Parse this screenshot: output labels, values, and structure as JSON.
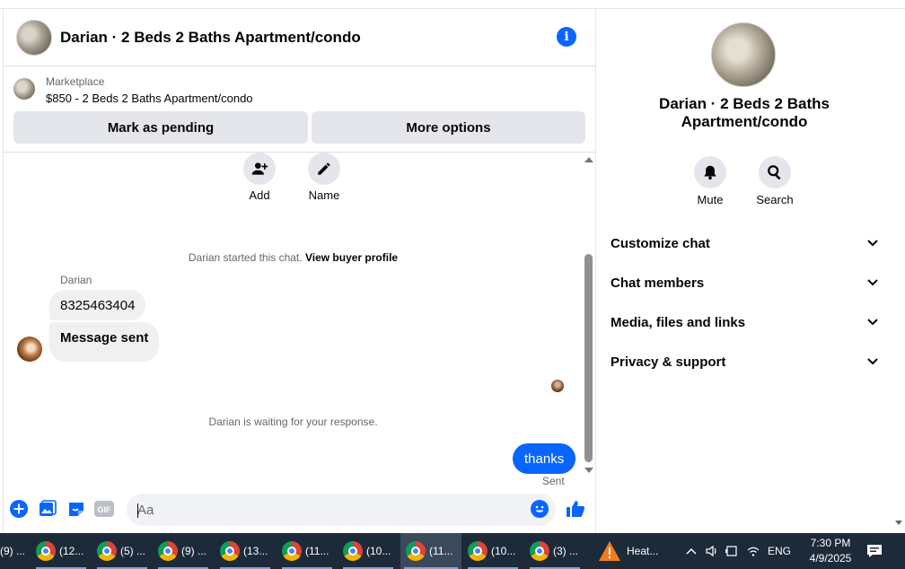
{
  "header": {
    "title": "Darian · 2 Beds 2 Baths Apartment/condo",
    "info_icon": "info-icon"
  },
  "marketplace": {
    "label": "Marketplace",
    "item": "$850 - 2 Beds 2 Baths Apartment/condo",
    "pending_button": "Mark as pending",
    "more_button": "More options"
  },
  "actions": {
    "add": "Add",
    "name": "Name"
  },
  "conversation": {
    "started_text": "Darian started this chat.",
    "view_profile": "View buyer profile",
    "sender": "Darian",
    "messages": [
      "8325463404",
      "Message sent"
    ],
    "waiting_text": "Darian is waiting for your response.",
    "my_message": "thanks",
    "sent_status": "Sent"
  },
  "composer": {
    "placeholder": "Aa"
  },
  "side": {
    "title": "Darian · 2 Beds 2 Baths Apartment/condo",
    "mute": "Mute",
    "search": "Search",
    "sections": [
      "Customize chat",
      "Chat members",
      "Media, files and links",
      "Privacy & support"
    ]
  },
  "taskbar": {
    "tasks": [
      "(9) ...",
      "(12...",
      "(5) ...",
      "(9) ...",
      "(13...",
      "(11...",
      "(10...",
      "(11...",
      "(10...",
      "(3) ..."
    ],
    "weather": "Heat...",
    "language": "ENG",
    "time": "7:30 PM",
    "date": "4/9/2025"
  },
  "colors": {
    "accent": "#0866ff",
    "bubble_gray": "#f0f0f0",
    "button_gray": "#e4e6eb",
    "taskbar": "#1c2a3a"
  }
}
